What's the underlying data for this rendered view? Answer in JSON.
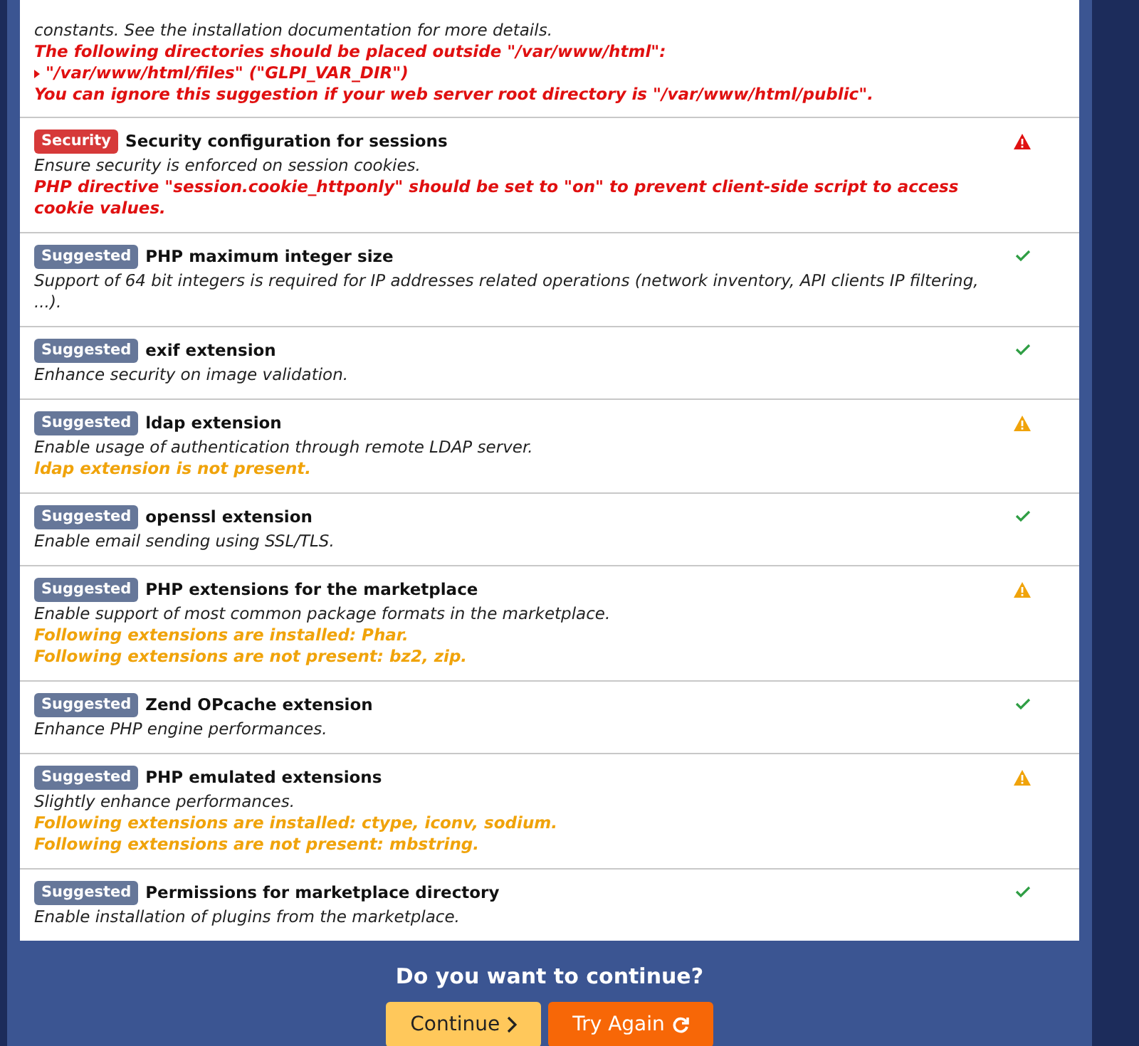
{
  "checks": [
    {
      "description": "constants. See the installation documentation for more details.",
      "messages": [
        {
          "kind": "error",
          "text": "The following directories should be placed outside \"/var/www/html\":"
        },
        {
          "kind": "error-item",
          "text": "\"/var/www/html/files\" (\"GLPI_VAR_DIR\")"
        },
        {
          "kind": "error",
          "text": "You can ignore this suggestion if your web server root directory is \"/var/www/html/public\"."
        }
      ]
    },
    {
      "badge": {
        "kind": "security",
        "label": "Security"
      },
      "title": "Security configuration for sessions",
      "kind": "error",
      "description": "Ensure security is enforced on session cookies.",
      "messages": [
        {
          "kind": "error",
          "text": "PHP directive \"session.cookie_httponly\" should be set to \"on\" to prevent client-side script to access cookie values."
        }
      ]
    },
    {
      "badge": {
        "kind": "suggested",
        "label": "Suggested"
      },
      "title": "PHP maximum integer size",
      "kind": "ok",
      "description": "Support of 64 bit integers is required for IP addresses related operations (network inventory, API clients IP filtering, ...)."
    },
    {
      "badge": {
        "kind": "suggested",
        "label": "Suggested"
      },
      "title": "exif extension",
      "kind": "ok",
      "description": "Enhance security on image validation."
    },
    {
      "badge": {
        "kind": "suggested",
        "label": "Suggested"
      },
      "title": "ldap extension",
      "kind": "warning",
      "description": "Enable usage of authentication through remote LDAP server.",
      "messages": [
        {
          "kind": "warning",
          "text": "ldap extension is not present."
        }
      ]
    },
    {
      "badge": {
        "kind": "suggested",
        "label": "Suggested"
      },
      "title": "openssl extension",
      "kind": "ok",
      "description": "Enable email sending using SSL/TLS."
    },
    {
      "badge": {
        "kind": "suggested",
        "label": "Suggested"
      },
      "title": "PHP extensions for the marketplace",
      "kind": "warning",
      "description": "Enable support of most common package formats in the marketplace.",
      "messages": [
        {
          "kind": "warning",
          "text": "Following extensions are installed: Phar."
        },
        {
          "kind": "warning",
          "text": "Following extensions are not present: bz2, zip."
        }
      ]
    },
    {
      "badge": {
        "kind": "suggested",
        "label": "Suggested"
      },
      "title": "Zend OPcache extension",
      "kind": "ok",
      "description": "Enhance PHP engine performances."
    },
    {
      "badge": {
        "kind": "suggested",
        "label": "Suggested"
      },
      "title": "PHP emulated extensions",
      "kind": "warning",
      "description": "Slightly enhance performances.",
      "messages": [
        {
          "kind": "warning",
          "text": "Following extensions are installed: ctype, iconv, sodium."
        },
        {
          "kind": "warning",
          "text": "Following extensions are not present: mbstring."
        }
      ]
    },
    {
      "badge": {
        "kind": "suggested",
        "label": "Suggested"
      },
      "title": "Permissions for marketplace directory",
      "kind": "ok",
      "description": "Enable installation of plugins from the marketplace."
    }
  ],
  "question": "Do you want to continue?",
  "buttons": [
    {
      "kind": "continue",
      "label": "Continue"
    },
    {
      "kind": "retry",
      "label": "Try Again"
    }
  ]
}
